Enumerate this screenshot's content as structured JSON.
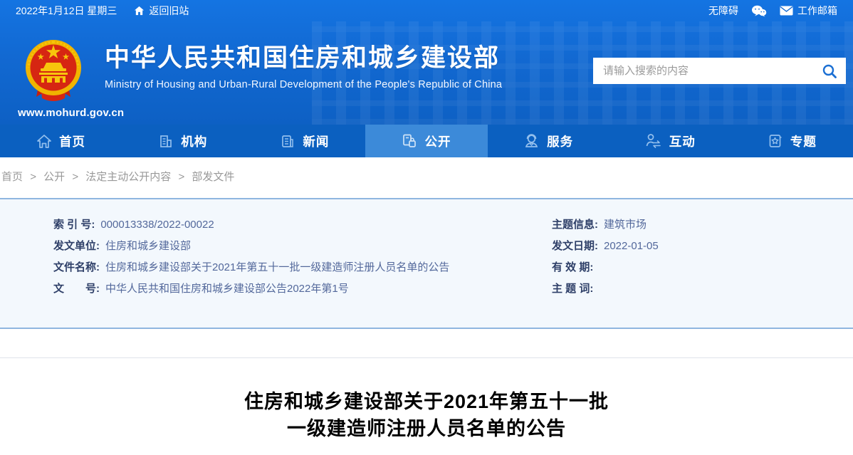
{
  "topbar": {
    "date": "2022年1月12日 星期三",
    "old_site_link": "返回旧站",
    "accessibility_link": "无障碍",
    "mailbox_link": "工作邮箱"
  },
  "header": {
    "site_name": "中华人民共和国住房和城乡建设部",
    "site_name_en": "Ministry of Housing and Urban-Rural Development of the People's Republic of China",
    "site_url": "www.mohurd.gov.cn",
    "search_placeholder": "请输入搜索的内容"
  },
  "nav": {
    "items": [
      {
        "label": "首页",
        "icon": "home-icon",
        "active": false
      },
      {
        "label": "机构",
        "icon": "building-icon",
        "active": false
      },
      {
        "label": "新闻",
        "icon": "news-icon",
        "active": false
      },
      {
        "label": "公开",
        "icon": "disclosure-icon",
        "active": true
      },
      {
        "label": "服务",
        "icon": "service-icon",
        "active": false
      },
      {
        "label": "互动",
        "icon": "interaction-icon",
        "active": false
      },
      {
        "label": "专题",
        "icon": "topics-icon",
        "active": false
      }
    ]
  },
  "breadcrumb": {
    "separator": ">",
    "items": [
      "首页",
      "公开",
      "法定主动公开内容",
      "部发文件"
    ]
  },
  "metadata": {
    "left": [
      {
        "label": "索 引 号:",
        "value": "000013338/2022-00022"
      },
      {
        "label": "发文单位:",
        "value": "住房和城乡建设部"
      },
      {
        "label": "文件名称:",
        "value": "住房和城乡建设部关于2021年第五十一批一级建造师注册人员名单的公告"
      },
      {
        "label": "文　　号:",
        "value": "中华人民共和国住房和城乡建设部公告2022年第1号"
      }
    ],
    "right": [
      {
        "label": "主题信息:",
        "value": "建筑市场"
      },
      {
        "label": "发文日期:",
        "value": "2022-01-05"
      },
      {
        "label": "有 效 期:",
        "value": ""
      },
      {
        "label": "主 题 词:",
        "value": ""
      }
    ]
  },
  "article": {
    "title_line1": "住房和城乡建设部关于2021年第五十一批",
    "title_line2": "一级建造师注册人员名单的公告"
  },
  "colors": {
    "header_blue": "#1269d2",
    "nav_blue": "#0b60c0",
    "nav_active_blue": "#3c8ad9",
    "meta_bg": "#f3f8fd",
    "meta_border": "#8fb6e0",
    "emblem_gold": "#f0b400",
    "emblem_red": "#d62612"
  }
}
